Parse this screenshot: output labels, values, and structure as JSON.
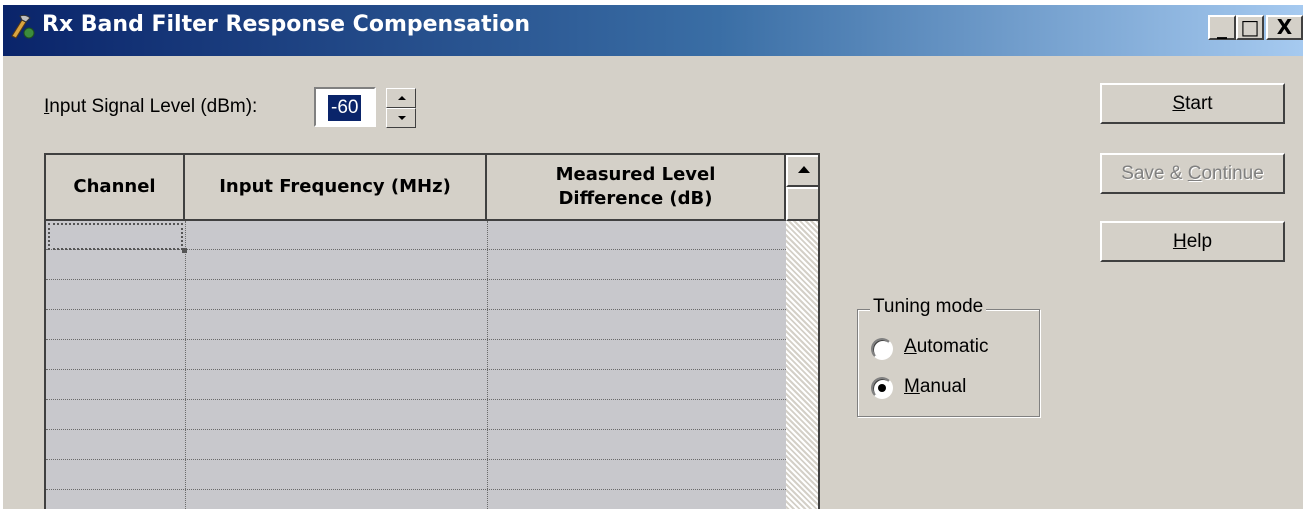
{
  "window": {
    "title": "Rx Band Filter Response Compensation",
    "controls": {
      "minimize": "_",
      "maximize": "□",
      "close": "X"
    }
  },
  "input_level": {
    "label_prefix": "I",
    "label_rest": "nput Signal Level (dBm):",
    "value": "-60"
  },
  "buttons": {
    "start": {
      "mnemonic": "S",
      "rest": "tart"
    },
    "save_continue": {
      "prefix": "Save & ",
      "mnemonic": "C",
      "rest": "ontinue",
      "disabled": true
    },
    "help": {
      "mnemonic": "H",
      "rest": "elp"
    }
  },
  "table": {
    "headers": [
      "Channel",
      "Input Frequency (MHz)",
      "Measured Level\nDifference (dB)"
    ],
    "rows": []
  },
  "tuning_mode": {
    "title": "Tuning mode",
    "options": [
      {
        "mnemonic": "A",
        "rest": "utomatic",
        "selected": false
      },
      {
        "mnemonic": "M",
        "rest": "anual",
        "selected": true
      }
    ]
  },
  "colors": {
    "titlebar_start": "#0a246a",
    "titlebar_end": "#a6caf0",
    "face": "#d4d0c8",
    "selection": "#0a246a"
  }
}
